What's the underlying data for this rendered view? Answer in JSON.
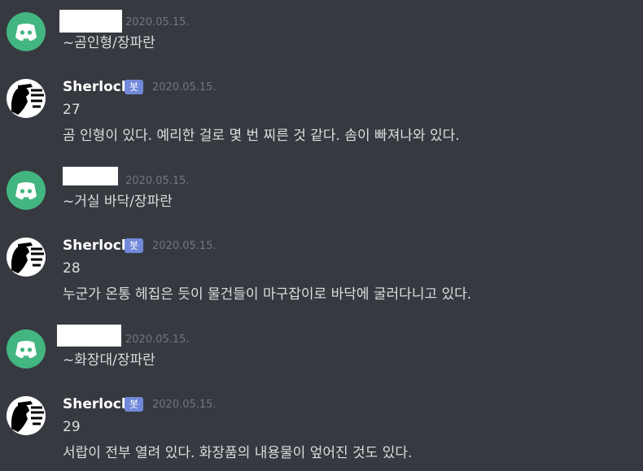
{
  "messages": [
    {
      "author_type": "user",
      "author_name": "",
      "timestamp": "2020.05.15.",
      "lines": [
        "~곰인형/장파란"
      ]
    },
    {
      "author_type": "bot",
      "author_name": "Sherlock",
      "bot_tag": "봇",
      "timestamp": "2020.05.15.",
      "lines": [
        "27",
        "곰 인형이 있다. 예리한 걸로 몇 번 찌른 것 같다. 솜이 빠져나와 있다."
      ]
    },
    {
      "author_type": "user",
      "author_name": "",
      "timestamp": "2020.05.15.",
      "lines": [
        "~거실 바닥/장파란"
      ]
    },
    {
      "author_type": "bot",
      "author_name": "Sherlock",
      "bot_tag": "봇",
      "timestamp": "2020.05.15.",
      "lines": [
        "28",
        "누군가 온통 헤집은 듯이 물건들이 마구잡이로 바닥에 굴러다니고 있다."
      ]
    },
    {
      "author_type": "user",
      "author_name": "",
      "timestamp": "2020.05.15.",
      "lines": [
        "~화장대/장파란"
      ]
    },
    {
      "author_type": "bot",
      "author_name": "Sherlock",
      "bot_tag": "봇",
      "timestamp": "2020.05.15.",
      "lines": [
        "29",
        "서랍이 전부 열려 있다. 화장품의 내용물이 엎어진 것도 있다."
      ]
    }
  ],
  "colors": {
    "background": "#36393f",
    "discord_avatar": "#43b581",
    "bot_tag": "#7289da",
    "timestamp": "#72767d",
    "message_text": "#dcddde",
    "username": "#ffffff"
  },
  "icons": {
    "user_avatar": "discord-logo-icon",
    "bot_avatar": "sherlock-silhouette-icon"
  }
}
